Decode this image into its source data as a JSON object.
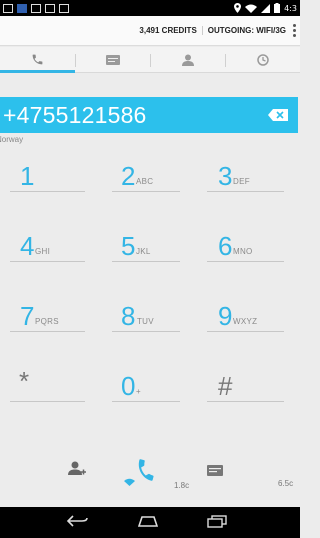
{
  "status_bar": {
    "time": "4:3",
    "notification_icons": [
      "gmail-icon",
      "app-icon",
      "image-icon",
      "image-icon",
      "bag-icon"
    ],
    "right_icons": [
      "location-icon",
      "wifi-icon",
      "signal-icon",
      "battery-icon"
    ]
  },
  "header": {
    "credits": "3,491 CREDITS",
    "outgoing": "OUTGOING: WIFI/3G"
  },
  "tabs": [
    {
      "icon": "phone-icon",
      "active": true
    },
    {
      "icon": "message-icon",
      "active": false
    },
    {
      "icon": "contacts-icon",
      "active": false
    },
    {
      "icon": "history-icon",
      "active": false
    }
  ],
  "dialer": {
    "number": "+4755121586",
    "country": "Norway"
  },
  "keys": [
    {
      "digit": "1",
      "letters": ""
    },
    {
      "digit": "2",
      "letters": "ABC"
    },
    {
      "digit": "3",
      "letters": "DEF"
    },
    {
      "digit": "4",
      "letters": "GHI"
    },
    {
      "digit": "5",
      "letters": "JKL"
    },
    {
      "digit": "6",
      "letters": "MNO"
    },
    {
      "digit": "7",
      "letters": "PQRS"
    },
    {
      "digit": "8",
      "letters": "TUV"
    },
    {
      "digit": "9",
      "letters": "WXYZ"
    },
    {
      "digit": "*",
      "letters": ""
    },
    {
      "digit": "0",
      "letters": "+"
    },
    {
      "digit": "#",
      "letters": ""
    }
  ],
  "actions": {
    "call_cost": "1.8c",
    "sms_cost": "6.5c"
  },
  "colors": {
    "accent": "#33b5e5",
    "number_bar": "#2cc0ec"
  }
}
